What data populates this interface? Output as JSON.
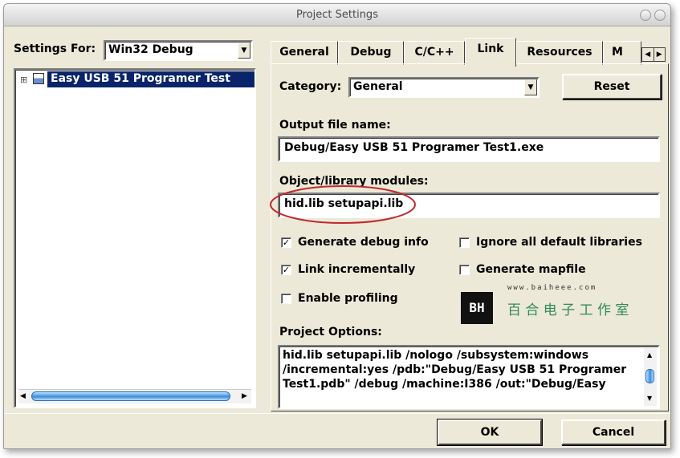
{
  "window": {
    "title": "Project Settings"
  },
  "left": {
    "settings_for_label": "Settings For:",
    "settings_for_value": "Win32 Debug",
    "tree": {
      "expand": "⊞",
      "project_name": "Easy USB 51 Programer Test"
    }
  },
  "tabs": [
    {
      "label": "General"
    },
    {
      "label": "Debug"
    },
    {
      "label": "C/C++"
    },
    {
      "label": "Link"
    },
    {
      "label": "Resources"
    },
    {
      "label": "M"
    }
  ],
  "link": {
    "category_label": "Category:",
    "category_value": "General",
    "reset_label": "Reset",
    "output_label": "Output file name:",
    "output_value": "Debug/Easy USB 51 Programer Test1.exe",
    "modules_label": "Object/library modules:",
    "modules_value": "hid.lib setupapi.lib",
    "options": {
      "generate_debug": {
        "label": "Generate debug info",
        "checked": true
      },
      "ignore_libs": {
        "label": "Ignore all default libraries",
        "checked": false
      },
      "link_incr": {
        "label": "Link incrementally",
        "checked": true
      },
      "gen_mapfile": {
        "label": "Generate mapfile",
        "checked": false
      },
      "enable_profiling": {
        "label": "Enable profiling",
        "checked": false
      }
    },
    "project_options_label": "Project Options:",
    "project_options_lines": [
      "hid.lib setupapi.lib /nologo /subsystem:windows",
      "/incremental:yes /pdb:\"Debug/Easy USB 51 Programer",
      "Test1.pdb\" /debug /machine:I386 /out:\"Debug/Easy"
    ]
  },
  "watermark": {
    "url": "www.baiheee.com",
    "logo": "BH",
    "chinese": "百 合 电 子 工 作 室"
  },
  "footer": {
    "ok_label": "OK",
    "cancel_label": "Cancel"
  },
  "colors": {
    "selection": "#0a246a",
    "annotation": "#c0282d",
    "face": "#ece9d8"
  }
}
